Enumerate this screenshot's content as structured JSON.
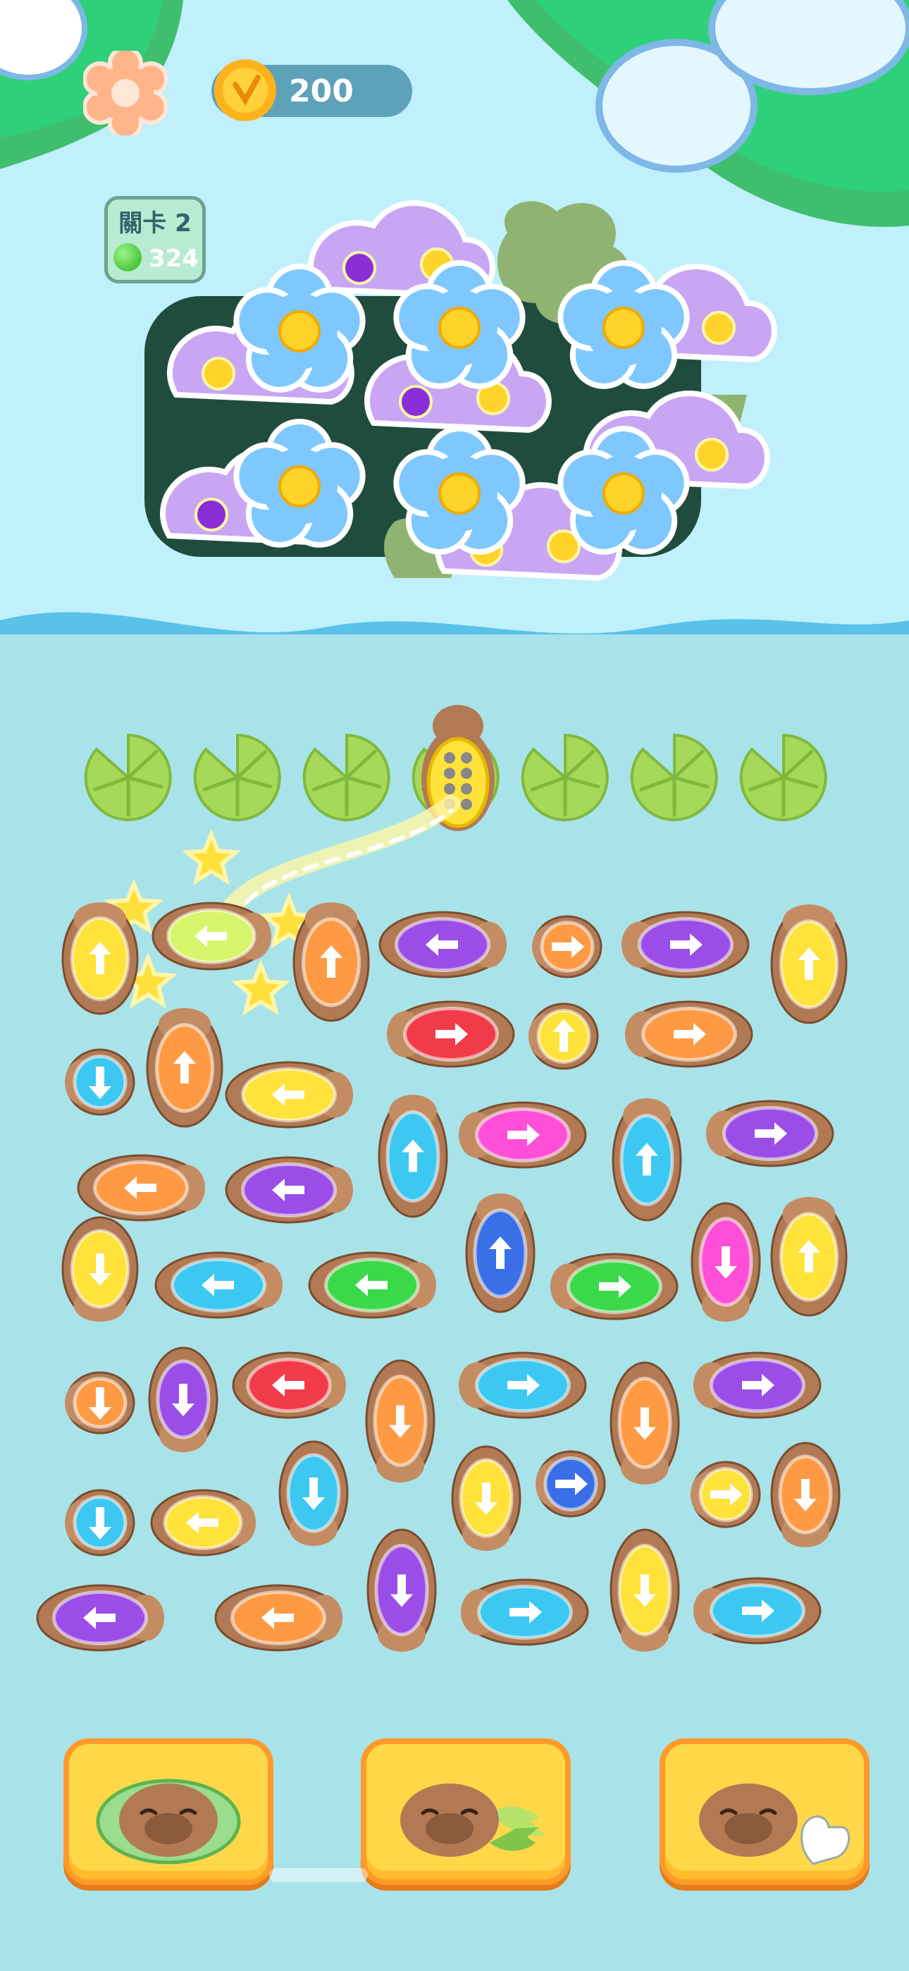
{
  "hud": {
    "coins": "200",
    "level_label": "關卡 2",
    "gems": "324",
    "icons": {
      "settings": "gear-flower-icon",
      "coin": "coin-icon",
      "gem": "green-gem-icon"
    }
  },
  "slots": {
    "total": 7,
    "filled": 1
  },
  "boosters": [
    {
      "name": "lily-pad-booster",
      "icon": "capybara-on-pad-icon"
    },
    {
      "name": "swap-booster",
      "icon": "capybara-swap-arrows-icon"
    },
    {
      "name": "tap-booster",
      "icon": "capybara-hand-tap-icon"
    }
  ],
  "colors": {
    "yellow": "#ffe23a",
    "orange": "#ff9a44",
    "purple": "#9b4de8",
    "red": "#f23b4a",
    "cyan": "#3dc8f2",
    "pink": "#ff4fd8",
    "blue": "#3a6fe8",
    "green": "#3bd94a",
    "capybara": "#b27a54"
  },
  "board": [
    {
      "color": "yellow",
      "dir": "up"
    },
    {
      "color": "lime",
      "dir": "left"
    },
    {
      "color": "orange",
      "dir": "up"
    },
    {
      "color": "purple",
      "dir": "left"
    },
    {
      "color": "orange",
      "dir": "right"
    },
    {
      "color": "purple",
      "dir": "right"
    },
    {
      "color": "yellow",
      "dir": "up"
    },
    {
      "color": "red",
      "dir": "right"
    },
    {
      "color": "yellow",
      "dir": "up"
    },
    {
      "color": "orange",
      "dir": "right"
    },
    {
      "color": "cyan",
      "dir": "down"
    },
    {
      "color": "orange",
      "dir": "up"
    },
    {
      "color": "yellow",
      "dir": "left"
    },
    {
      "color": "cyan",
      "dir": "up"
    },
    {
      "color": "pink",
      "dir": "right"
    },
    {
      "color": "cyan",
      "dir": "up"
    },
    {
      "color": "purple",
      "dir": "right"
    },
    {
      "color": "orange",
      "dir": "left"
    },
    {
      "color": "purple",
      "dir": "left"
    },
    {
      "color": "blue",
      "dir": "up"
    },
    {
      "color": "yellow",
      "dir": "down"
    },
    {
      "color": "cyan",
      "dir": "left"
    },
    {
      "color": "green",
      "dir": "left"
    },
    {
      "color": "green",
      "dir": "right"
    },
    {
      "color": "pink",
      "dir": "down"
    },
    {
      "color": "yellow",
      "dir": "up"
    },
    {
      "color": "orange",
      "dir": "down"
    },
    {
      "color": "purple",
      "dir": "down"
    },
    {
      "color": "red",
      "dir": "left"
    },
    {
      "color": "orange",
      "dir": "down"
    },
    {
      "color": "cyan",
      "dir": "right"
    },
    {
      "color": "orange",
      "dir": "down"
    },
    {
      "color": "purple",
      "dir": "right"
    },
    {
      "color": "cyan",
      "dir": "down"
    },
    {
      "color": "yellow",
      "dir": "left"
    },
    {
      "color": "cyan",
      "dir": "down"
    },
    {
      "color": "yellow",
      "dir": "down"
    },
    {
      "color": "blue",
      "dir": "right"
    },
    {
      "color": "yellow",
      "dir": "right"
    },
    {
      "color": "orange",
      "dir": "down"
    },
    {
      "color": "purple",
      "dir": "left"
    },
    {
      "color": "orange",
      "dir": "left"
    },
    {
      "color": "purple",
      "dir": "down"
    },
    {
      "color": "cyan",
      "dir": "right"
    },
    {
      "color": "yellow",
      "dir": "down"
    },
    {
      "color": "cyan",
      "dir": "right"
    }
  ]
}
